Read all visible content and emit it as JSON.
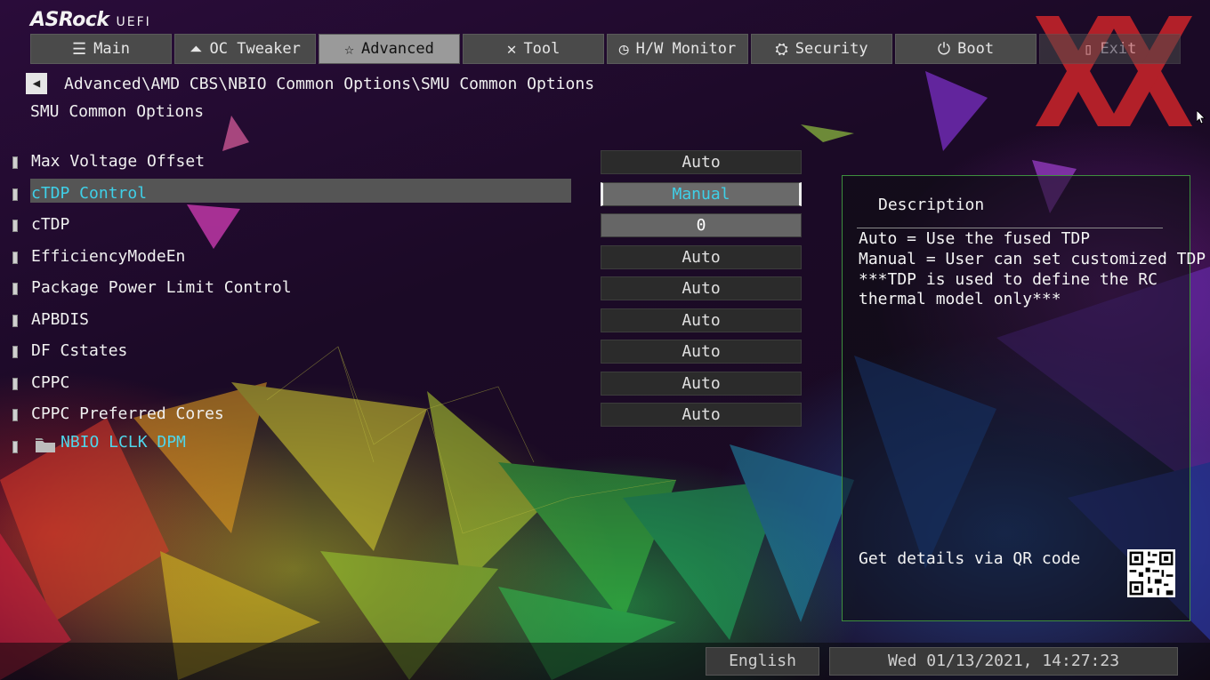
{
  "logo": {
    "brand": "ASRock",
    "suffix": "UEFI"
  },
  "tabs": [
    {
      "label": "Main",
      "icon": "list-icon",
      "active": false
    },
    {
      "label": "OC Tweaker",
      "icon": "rocket-icon",
      "active": false
    },
    {
      "label": "Advanced",
      "icon": "star-icon",
      "active": true
    },
    {
      "label": "Tool",
      "icon": "tools-icon",
      "active": false
    },
    {
      "label": "H/W Monitor",
      "icon": "monitor-gauge-icon",
      "active": false
    },
    {
      "label": "Security",
      "icon": "shield-icon",
      "active": false
    },
    {
      "label": "Boot",
      "icon": "power-icon",
      "active": false
    },
    {
      "label": "Exit",
      "icon": "exit-door-icon",
      "active": false
    }
  ],
  "breadcrumb": "Advanced\\AMD CBS\\NBIO Common Options\\SMU Common Options",
  "page_title": "SMU Common Options",
  "settings": [
    {
      "label": "Max Voltage Offset",
      "value": "Auto"
    },
    {
      "label": "cTDP Control",
      "value": "Manual",
      "selected": true
    },
    {
      "label": "cTDP",
      "value": "0"
    },
    {
      "label": "EfficiencyModeEn",
      "value": "Auto"
    },
    {
      "label": "Package Power Limit Control",
      "value": "Auto"
    },
    {
      "label": "APBDIS",
      "value": "Auto"
    },
    {
      "label": "DF Cstates",
      "value": "Auto"
    },
    {
      "label": "CPPC",
      "value": "Auto"
    },
    {
      "label": "CPPC Preferred Cores",
      "value": "Auto"
    },
    {
      "label": "NBIO LCLK DPM",
      "submenu": true
    }
  ],
  "description": {
    "heading": "Description",
    "lines": [
      "Auto = Use the fused TDP",
      "Manual = User can set customized TDP",
      "***TDP is used to define the RC",
      "thermal model only***"
    ],
    "qr_text": "Get details via QR code"
  },
  "footer": {
    "language": "English",
    "datetime": "Wed 01/13/2021, 14:27:23"
  },
  "colors": {
    "accent_cyan": "#3fd0e8",
    "tab_active": "#9a9a9a",
    "tab_bg": "#4a4a4a",
    "desc_border": "#3e8f3e",
    "watermark_red": "#d8262a"
  }
}
